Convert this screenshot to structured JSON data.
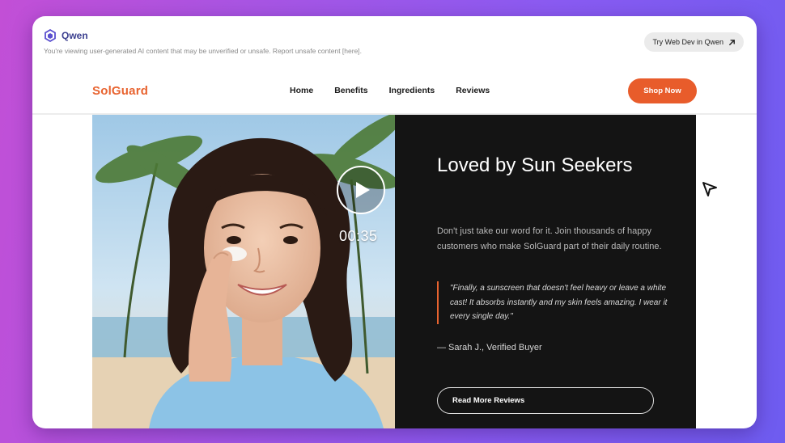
{
  "topbar": {
    "brand": "Qwen",
    "disclaimer": "You're viewing user-generated AI content that may be unverified or unsafe. Report unsafe content [here].",
    "try_button": "Try Web Dev in Qwen",
    "icons": {
      "brand": "qwen-logo-icon",
      "external": "arrow-up-right-icon"
    }
  },
  "nav": {
    "logo": "SolGuard",
    "links": [
      "Home",
      "Benefits",
      "Ingredients",
      "Reviews"
    ],
    "cta": "Shop Now"
  },
  "hero": {
    "title": "Loved by Sun Seekers",
    "body": "Don't just take our word for it. Join thousands of happy customers who make SolGuard part of their daily routine.",
    "quote": "\"Finally, a sunscreen that doesn't feel heavy or leave a white cast! It absorbs instantly and my skin feels amazing. I wear it every single day.\"",
    "author": "— Sarah J., Verified Buyer",
    "reviews_button": "Read More Reviews"
  },
  "video": {
    "timecode": "00:35",
    "play_icon": "play-icon"
  },
  "colors": {
    "accent": "#e85c2b",
    "panel": "#141414",
    "background_start": "#c24fd6",
    "background_end": "#6e5cf0"
  }
}
